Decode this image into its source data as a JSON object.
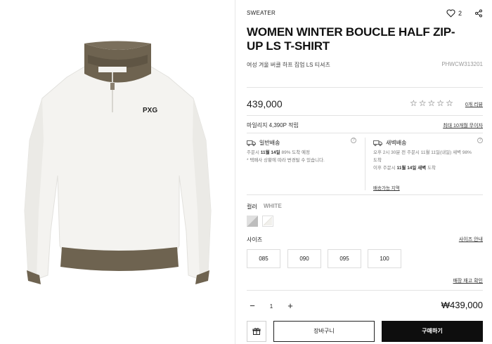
{
  "product": {
    "category": "SWEATER",
    "title": "WOMEN WINTER BOUCLE HALF ZIP-UP LS T-SHIRT",
    "subtitle": "여성 겨울 버클 하프 집업 LS 티셔츠",
    "code": "PHWCW313201",
    "like_count": "2",
    "price": "439,000",
    "review_link": "0개 리뷰",
    "mileage": "마일리지 4,390P 적립",
    "installment": "최대 10개월 무이자",
    "logo_text": "PXG"
  },
  "delivery": {
    "standard": {
      "title": "일반배송",
      "line1_prefix": "주문시",
      "line1_date": "11월 14일",
      "line1_suffix": "89% 도착 예정",
      "line2": "* 택배사 상황에 따라 변경될 수 있습니다."
    },
    "dawn": {
      "title": "새벽배송",
      "line1": "오후 2시 30분 전 주문시 11월 11일(내일) 새벽 98%",
      "line2": "도착",
      "line3_prefix": "이후 주문시",
      "line3_date": "11월 14일 새벽",
      "line3_suffix": "도착",
      "region_link": "배송가능 지역"
    }
  },
  "options": {
    "color_label": "컬러",
    "color_value": "WHITE",
    "size_label": "사이즈",
    "size_guide": "사이즈 안내",
    "sizes": [
      "085",
      "090",
      "095",
      "100"
    ],
    "stock_link": "매장 재고 확인"
  },
  "order": {
    "quantity": "1",
    "minus": "−",
    "plus": "+",
    "total": "₩439,000",
    "cart_label": "장바구니",
    "buy_label": "구매하기"
  },
  "colors": {
    "sweater": "#f4f3f0",
    "trim": "#6e6350",
    "buy_button": "#0e0e0e"
  }
}
